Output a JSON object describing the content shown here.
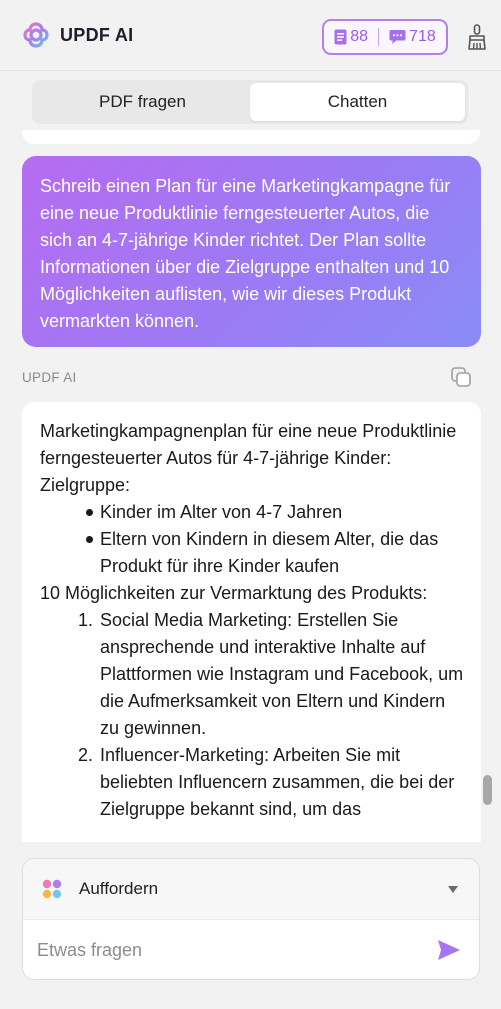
{
  "header": {
    "title": "UPDF AI",
    "quota": {
      "docs": "88",
      "chats": "718"
    }
  },
  "tabs": [
    {
      "label": "PDF fragen",
      "active": false
    },
    {
      "label": "Chatten",
      "active": true
    }
  ],
  "conversation": {
    "user_message": "Schreib einen Plan für eine Marketingkampagne für eine neue Produktlinie ferngesteuerter Autos, die sich an 4-7-jährige Kinder richtet. Der Plan sollte Informationen über die Zielgruppe enthalten und 10 Möglichkeiten auflisten, wie wir dieses Produkt vermarkten können.",
    "ai_label": "UPDF AI",
    "ai_response": {
      "heading": "Marketingkampagnenplan für eine neue Produktlinie ferngesteuerter Autos für 4-7-jährige Kinder:",
      "target_label": "Zielgruppe:",
      "target_items": [
        "Kinder im Alter von 4-7 Jahren",
        "Eltern von Kindern in diesem Alter, die das Produkt für ihre Kinder kaufen"
      ],
      "ways_label": "10 Möglichkeiten zur Vermarktung des Produkts:",
      "ways": [
        {
          "num": "1.",
          "text": "Social Media Marketing: Erstellen Sie ansprechende und interaktive Inhalte auf Plattformen wie Instagram und Facebook, um die Aufmerksamkeit von Eltern und Kindern zu gewinnen."
        },
        {
          "num": "2.",
          "text": "Influencer-Marketing: Arbeiten Sie mit beliebten Influencern zusammen, die bei der Zielgruppe bekannt sind, um das"
        }
      ]
    }
  },
  "composer": {
    "prompt_label": "Auffordern",
    "placeholder": "Etwas fragen"
  },
  "colors": {
    "accent": "#a76ef0",
    "bubble_gradient_start": "#b66cf0",
    "bubble_gradient_end": "#8a8cf7",
    "background": "#f2f2f2"
  },
  "icons": {
    "logo": "updf-logo-icon",
    "docs": "document-icon",
    "chats": "chat-bubble-icon",
    "clear": "broom-icon",
    "copy": "copy-icon",
    "prompt": "prompt-dots-icon",
    "dropdown": "chevron-down-icon",
    "send": "send-icon"
  }
}
